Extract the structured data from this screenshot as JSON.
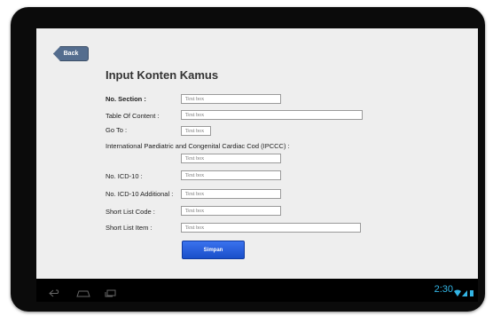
{
  "toolbar": {
    "back_label": "Back"
  },
  "form": {
    "title": "Input Konten Kamus",
    "fields": [
      {
        "label": "No. Section :",
        "placeholder": "Text box"
      },
      {
        "label": "Table Of Content :",
        "placeholder": "Text box"
      },
      {
        "label": "Go To :",
        "placeholder": "Text box"
      },
      {
        "label": "International Paediatric and Congenital Cardiac Cod (IPCCC) :",
        "placeholder": "Text box"
      },
      {
        "label": "No. ICD-10 :",
        "placeholder": "Text box"
      },
      {
        "label": "No. ICD-10 Additional :",
        "placeholder": "Text box"
      },
      {
        "label": "Short List Code :",
        "placeholder": "Text box"
      },
      {
        "label": "Short List Item :",
        "placeholder": "Text box"
      }
    ],
    "submit_label": "Simpan"
  },
  "navbar": {
    "icons": [
      "back-icon",
      "home-icon",
      "recent-apps-icon"
    ],
    "clock": "2:30",
    "status_icons": [
      "wifi-icon",
      "signal-icon",
      "battery-icon"
    ],
    "accent_color": "#33b5e5"
  }
}
